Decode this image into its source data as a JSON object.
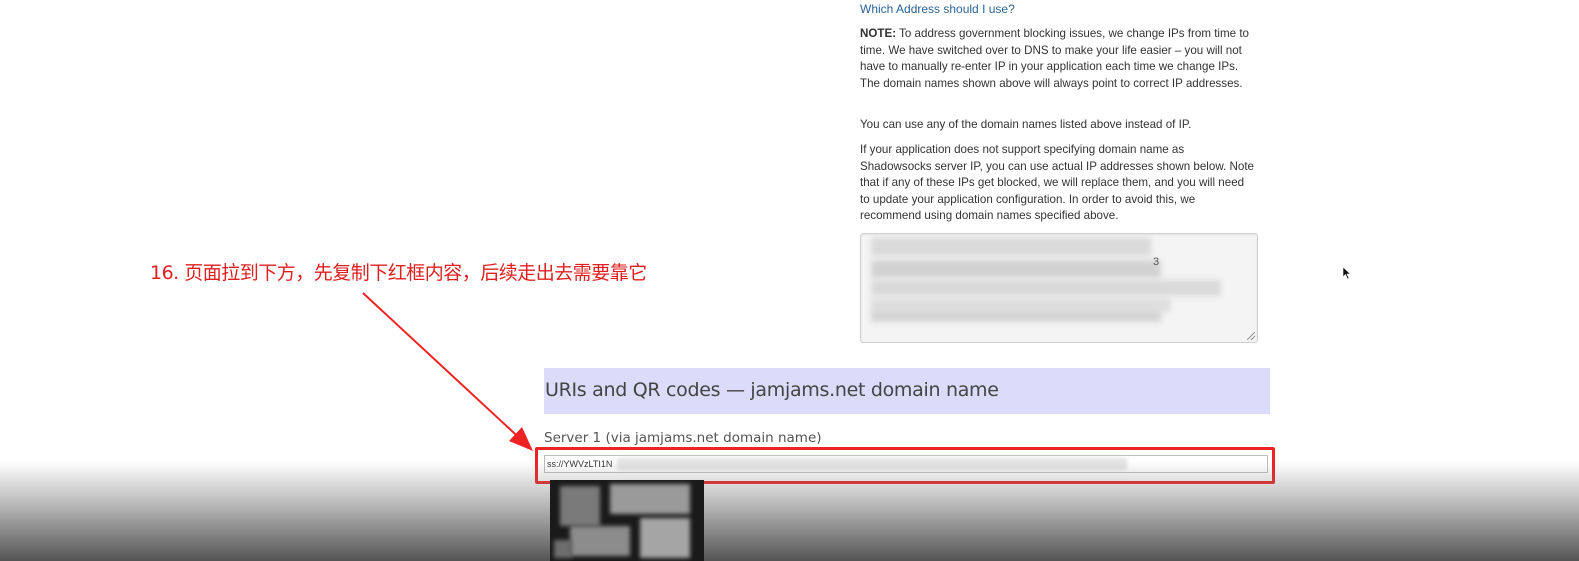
{
  "content": {
    "which_address_link": "Which Address should I use?",
    "note_label": "NOTE:",
    "note_text": " To address government blocking issues, we change IPs from time to time. We have switched over to DNS to make your life easier – you will not have to manually re-enter IP in your application each time we change IPs. The domain names shown above will always point to correct IP addresses.",
    "para2": "You can use any of the domain names listed above instead of IP.",
    "para3": "If your application does not support specifying domain name as Shadowsocks server IP, you can use actual IP addresses shown below. Note that if any of these IPs get blocked, we will replace them, and you will need to update your application configuration. In order to avoid this, we recommend using domain names specified above.",
    "ip_box_visible_char": "3"
  },
  "section": {
    "title": "URIs and QR codes — jamjams.net domain name",
    "server_label": "Server 1 (via jamjams.net domain name)",
    "uri_value": "ss://YWVzLTI1N"
  },
  "annotation": {
    "text": "16. 页面拉到下方，先复制下红框内容，后续走出去需要靠它"
  },
  "colors": {
    "annotation": "#e02020",
    "section_header_bg": "#dcdcfa",
    "link": "#2a6496"
  }
}
